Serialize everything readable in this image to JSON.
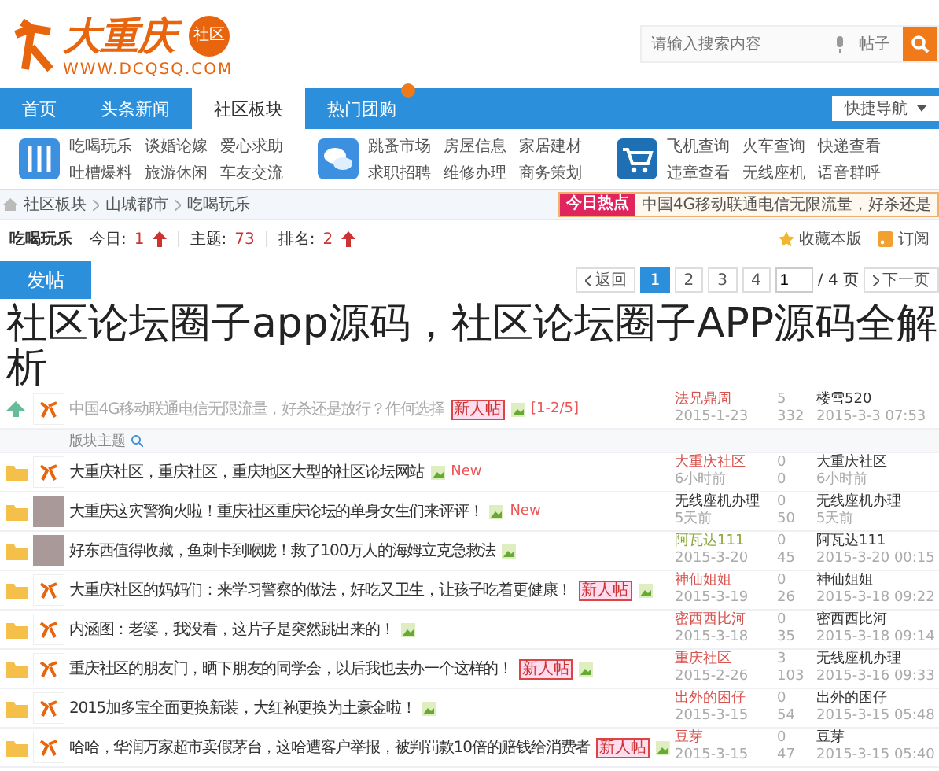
{
  "header": {
    "logo_text": "大重庆",
    "logo_badge": "社区",
    "logo_url": "WWW.DCQSQ.COM",
    "search": {
      "placeholder": "请输入搜索内容",
      "scope": "帖子"
    }
  },
  "nav": {
    "tabs": [
      {
        "label": "首页",
        "selected": false
      },
      {
        "label": "头条新闻",
        "selected": false
      },
      {
        "label": "社区板块",
        "selected": true
      },
      {
        "label": "热门团购",
        "selected": false
      }
    ],
    "quick_nav": "快捷导航"
  },
  "categories": [
    {
      "kind": "food",
      "links": [
        "吃喝玩乐",
        "谈婚论嫁",
        "爱心求助",
        "吐槽爆料",
        "旅游休闲",
        "车友交流"
      ]
    },
    {
      "kind": "chat",
      "links": [
        "跳蚤市场",
        "房屋信息",
        "家居建材",
        "求职招聘",
        "维修办理",
        "商务策划"
      ]
    },
    {
      "kind": "cart",
      "links": [
        "飞机查询",
        "火车查询",
        "快递查看",
        "违章查看",
        "无线座机",
        "语音群呼"
      ]
    }
  ],
  "breadcrumb": [
    "社区板块",
    "山城都市",
    "吃喝玩乐"
  ],
  "hot": {
    "label": "今日热点",
    "headline": "中国4G移动联通电信无限流量，好杀还是"
  },
  "forum": {
    "name": "吃喝玩乐",
    "today_label": "今日:",
    "today": "1",
    "topics_label": "主题:",
    "topics": "73",
    "rank_label": "排名:",
    "rank": "2",
    "favorite": "收藏本版",
    "subscribe": "订阅"
  },
  "toolbar": {
    "post": "发帖",
    "back": "返回",
    "pages": [
      {
        "label": "1",
        "selected": true
      },
      {
        "label": "2",
        "selected": false
      },
      {
        "label": "3",
        "selected": false
      },
      {
        "label": "4",
        "selected": false
      }
    ],
    "page_input": "1",
    "page_total": "/ 4 页",
    "next": "下一页"
  },
  "overlay_caption": "社区论坛圈子app源码，社区论坛圈子APP源码全解析",
  "sticky": {
    "title": "中国4G移动联通电信无限流量，好杀还是放行？作何选择",
    "tag": "新人帖",
    "pages": "[1-2/5]",
    "author": "法兄鼎周",
    "date": "2015-1-23",
    "replies": "5",
    "views": "332",
    "last_user": "楼雪520",
    "last_time": "2015-3-3 07:53"
  },
  "section_label": "版块主题",
  "threads": [
    {
      "kind": "logo",
      "title": "大重庆社区，重庆社区，重庆地区大型的社区论坛网站",
      "badge": "New",
      "author": "大重庆社区",
      "color": "#d9534f",
      "date": "6小时前",
      "replies": "0",
      "views": "0",
      "last_user": "大重庆社区",
      "last_time": "6小时前"
    },
    {
      "kind": "photo",
      "title": "大重庆这灾警狗火啦！重庆社区重庆论坛的单身女生们来评评！",
      "badge": "New",
      "author": "无线座机办理",
      "color": "#333333",
      "date": "5天前",
      "replies": "0",
      "views": "50",
      "last_user": "无线座机办理",
      "last_time": "5天前"
    },
    {
      "kind": "photo",
      "title": "好东西值得收藏，鱼刺卡到喉咙！救了100万人的海姆立克急救法",
      "author": "阿瓦达111",
      "color": "#8aa83a",
      "date": "2015-3-20",
      "replies": "0",
      "views": "45",
      "last_user": "阿瓦达111",
      "last_time": "2015-3-20 00:15"
    },
    {
      "kind": "logo",
      "title": "大重庆社区的妈妈们：来学习警察的做法，好吃又卫生，让孩子吃着更健康！",
      "tag": "新人帖",
      "author": "神仙姐姐",
      "color": "#d9534f",
      "date": "2015-3-19",
      "replies": "0",
      "views": "26",
      "last_user": "神仙姐姐",
      "last_time": "2015-3-18 09:22"
    },
    {
      "kind": "logo",
      "title": "内涵图：老婆，我没看，这片子是突然跳出来的！",
      "author": "密西西比河",
      "color": "#d9534f",
      "date": "2015-3-18",
      "replies": "0",
      "views": "35",
      "last_user": "密西西比河",
      "last_time": "2015-3-18 09:14"
    },
    {
      "kind": "logo",
      "title": "重庆社区的朋友门，晒下朋友的同学会，以后我也去办一个这样的！",
      "tag": "新人帖",
      "author": "重庆社区",
      "color": "#d9534f",
      "date": "2015-2-26",
      "replies": "3",
      "views": "103",
      "last_user": "无线座机办理",
      "last_time": "2015-3-16 09:33"
    },
    {
      "kind": "logo",
      "title": "2015加多宝全面更换新装，大红袍更换为土豪金啦！",
      "author": "出外的困仔",
      "color": "#d9534f",
      "date": "2015-3-15",
      "replies": "0",
      "views": "54",
      "last_user": "出外的困仔",
      "last_time": "2015-3-15 05:48"
    },
    {
      "kind": "logo",
      "title": "哈哈，华润万家超市卖假茅台，这哈遭客户举报，被判罚款10倍的赔钱给消费者",
      "tag": "新人帖",
      "author": "豆芽",
      "color": "#d9534f",
      "date": "2015-3-15",
      "replies": "0",
      "views": "47",
      "last_user": "豆芽",
      "last_time": "2015-3-15 05:40"
    }
  ]
}
